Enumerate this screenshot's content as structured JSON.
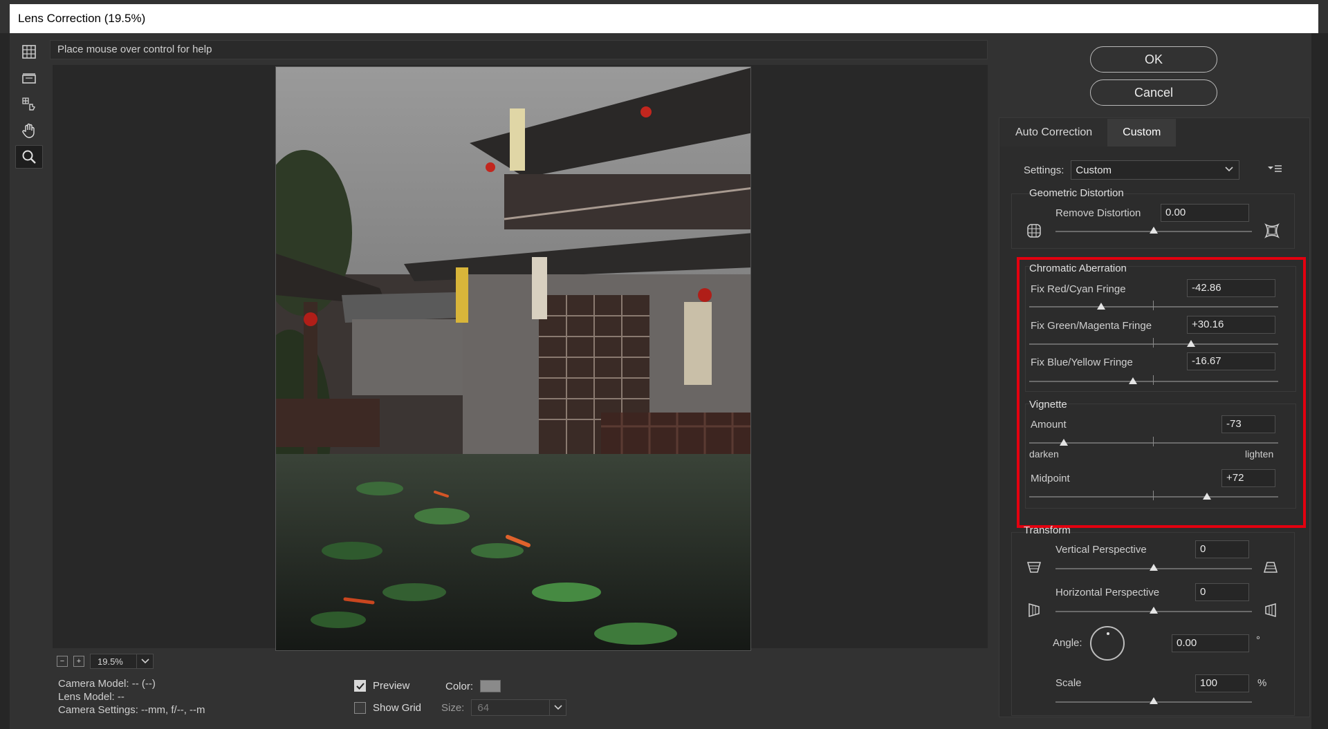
{
  "window": {
    "title": "Lens Correction (19.5%)"
  },
  "helpbar": {
    "text": "Place mouse over control for help"
  },
  "tools": [
    "remove-distortion-tool",
    "straighten-tool",
    "move-grid-tool",
    "hand-tool",
    "zoom-tool"
  ],
  "zoom": {
    "minus": "−",
    "plus": "+",
    "value": "19.5%"
  },
  "camera": {
    "model": "Camera Model: -- (--)",
    "lens": "Lens Model: --",
    "settings": "Camera Settings: --mm, f/--, --m"
  },
  "view": {
    "preview_label": "Preview",
    "preview_checked": true,
    "grid_label": "Show Grid",
    "grid_checked": false,
    "color_label": "Color:",
    "size_label": "Size:",
    "size_value": "64"
  },
  "buttons": {
    "ok": "OK",
    "cancel": "Cancel"
  },
  "tabs": [
    {
      "label": "Auto Correction"
    },
    {
      "label": "Custom"
    }
  ],
  "settings": {
    "label": "Settings:",
    "value": "Custom"
  },
  "geometric": {
    "title": "Geometric Distortion",
    "remove_label": "Remove Distortion",
    "remove_value": "0.00"
  },
  "chromatic": {
    "title": "Chromatic Aberration",
    "red_label": "Fix Red/Cyan Fringe",
    "red_value": "-42.86",
    "green_label": "Fix Green/Magenta Fringe",
    "green_value": "+30.16",
    "blue_label": "Fix Blue/Yellow Fringe",
    "blue_value": "-16.67"
  },
  "vignette": {
    "title": "Vignette",
    "amount_label": "Amount",
    "amount_value": "-73",
    "darken": "darken",
    "lighten": "lighten",
    "midpoint_label": "Midpoint",
    "midpoint_value": "+72"
  },
  "transform": {
    "title": "Transform",
    "vertical_label": "Vertical Perspective",
    "vertical_value": "0",
    "horizontal_label": "Horizontal Perspective",
    "horizontal_value": "0",
    "angle_label": "Angle:",
    "angle_value": "0.00",
    "angle_unit": "°",
    "scale_label": "Scale",
    "scale_value": "100",
    "scale_unit": "%"
  },
  "colors": {
    "highlight": "#e3000f",
    "panel_bg": "#2c2c2c",
    "dialog_bg": "#323232"
  }
}
